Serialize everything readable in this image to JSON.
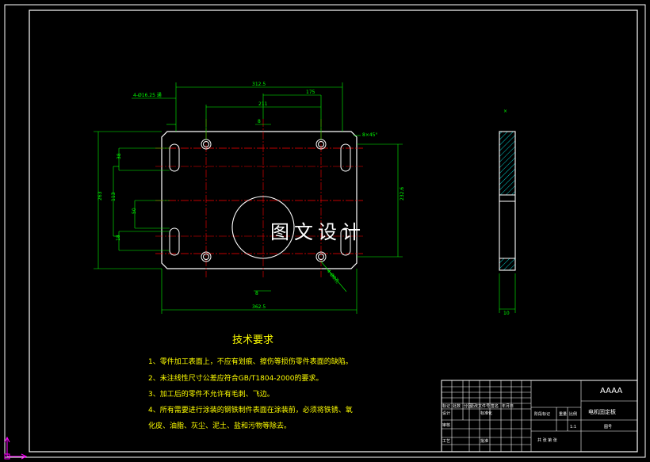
{
  "dimensions": {
    "holes": "4-Ø16.25 通",
    "width_top": "312.5",
    "span_top": "211",
    "right_offset": "175",
    "slot_top": "8",
    "chamfer": "8×45°",
    "height_total": "263",
    "slot_spacing_upper": "38",
    "middle_113": "113",
    "middle_50": "50",
    "slot_spacing_lower": "18",
    "height_right": "232.6",
    "slot_bottom": "8",
    "width_bottom": "362.5",
    "leader_note": "4-Ø8孔",
    "thickness": "10",
    "side_mark": "×"
  },
  "watermark": "图文设计",
  "tech_requirements": {
    "title": "技术要求",
    "items": [
      "1、零件加工表面上，不应有划痕、擦伤等损伤零件表面的缺陷。",
      "2、未注线性尺寸公差应符合GB/T1804-2000的要求。",
      "3、加工后的零件不允许有毛刺、飞边。",
      "4、所有需要进行涂装的钢铁制件表面在涂装前，必须将铁锈、氧",
      "化皮、油脂、灰尘、泥土、盐和污物等除去。"
    ]
  },
  "title_block": {
    "company": "AAAA",
    "part_name": "电机固定板",
    "drawing_no_label": "图号",
    "stage_label": "阶段标记",
    "weight_label": "重量",
    "scale_label": "比例",
    "scale_value": "1:1",
    "sheet_label": "共 张 第 张",
    "design_label": "设计",
    "check_label": "审核",
    "process_label": "工艺",
    "standard_label": "标准化",
    "approve_label": "批准",
    "mark_label": "标记",
    "count_label": "处数",
    "zone_label": "分区",
    "change_label": "更改文件号",
    "sign_label": "签名",
    "date_label": "年月日"
  },
  "colors": {
    "background": "#000000",
    "outline": "#ffffff",
    "dimension": "#00ff00",
    "centerline": "#ff0000",
    "text": "#ffff00",
    "hatch": "#00ffff",
    "ucs": "#ff00ff"
  }
}
